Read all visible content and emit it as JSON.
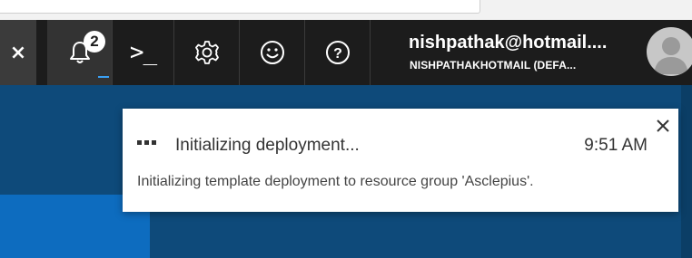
{
  "topbar": {
    "close_glyph": "×",
    "notifications": {
      "count": "2",
      "icon": "bell-icon"
    },
    "shell_glyph": ">_",
    "settings_icon": "gear-icon",
    "feedback_icon": "smiley-icon",
    "help_glyph": "?",
    "account": {
      "name": "nishpathak@hotmail....",
      "directory": "NISHPATHAKHOTMAIL (DEFA..."
    }
  },
  "notification": {
    "title": "Initializing deployment...",
    "time": "9:51 AM",
    "description": "Initializing template deployment to resource group 'Asclepius'."
  },
  "colors": {
    "topbar_bg": "#1c1c1c",
    "content_bg": "#0e4a7a",
    "accent_blue": "#3aa0f3"
  }
}
